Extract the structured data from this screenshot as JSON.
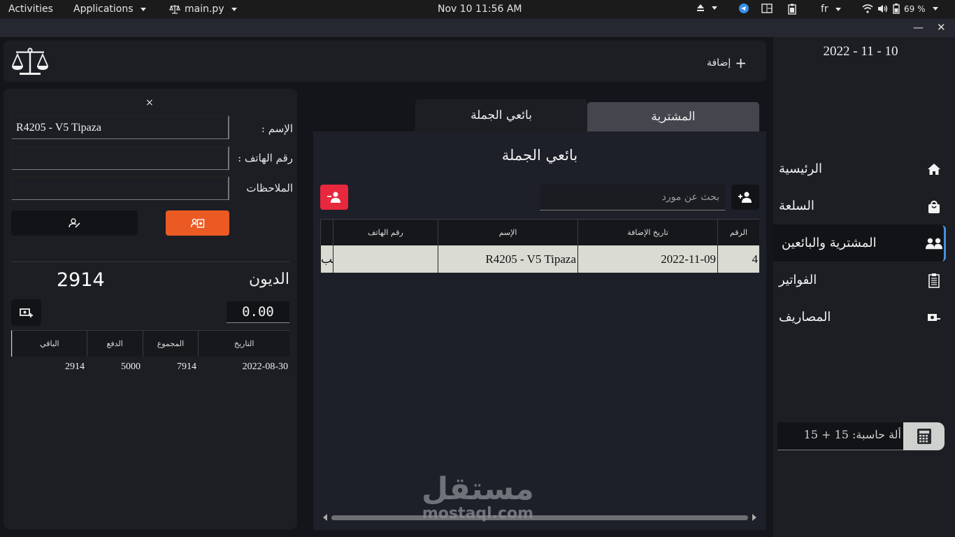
{
  "system_bar": {
    "activities": "Activities",
    "applications": "Applications",
    "app_name": "main.py",
    "datetime": "Nov 10  11:56 AM",
    "keyboard_layout": "fr",
    "battery": "69 %"
  },
  "window": {
    "minimize": "—",
    "close": "✕"
  },
  "header": {
    "add_label": "إضافة",
    "add_plus": "+"
  },
  "detail_panel": {
    "close": "×",
    "name_label": "الإسم :",
    "name_value": "R4205 - V5 Tipaza",
    "phone_label": "رقم الهاتف :",
    "phone_value": "",
    "notes_label": "الملاحظات",
    "notes_value": "",
    "debt_label": "الديون",
    "debt_value": "2914",
    "amount_value": "0.00",
    "table": {
      "headers": [
        "التاريخ",
        "المجموع",
        "الدفع",
        "الباقي"
      ],
      "rows": [
        [
          "2022-08-30",
          "7914",
          "5000",
          "2914"
        ]
      ]
    }
  },
  "tabs": [
    {
      "label": "المشترية",
      "active": false
    },
    {
      "label": "بائعي الجملة",
      "active": true
    }
  ],
  "main": {
    "title": "بائعي الجملة",
    "search_placeholder": "بحث عن مورد",
    "table": {
      "headers": [
        "الرقم",
        "تاريخ الإضافة",
        "الإسم",
        "رقم الهاتف",
        ""
      ],
      "rows": [
        [
          "4",
          "2022-11-09",
          "R4205 - V5 Tipaza",
          "",
          "حلب"
        ]
      ]
    }
  },
  "watermark": {
    "arabic": "مستقل",
    "latin": "mostaql.com"
  },
  "sidebar": {
    "date": "2022 - 11 - 10",
    "items": [
      {
        "label": "الرئيسية",
        "icon": "home-icon",
        "active": false
      },
      {
        "label": "السلعة",
        "icon": "shopping-bag-icon",
        "active": false
      },
      {
        "label": "المشترية والبائعين",
        "icon": "users-icon",
        "active": true
      },
      {
        "label": "الفواتير",
        "icon": "clipboard-icon",
        "active": false
      },
      {
        "label": "المصاريف",
        "icon": "money-icon",
        "active": false
      }
    ],
    "calculator_text": "ألة حاسبة: 15 + 15"
  },
  "colors": {
    "accent_orange": "#ec5a24",
    "danger_red": "#e8283c",
    "active_indicator": "#4a8fe0"
  }
}
